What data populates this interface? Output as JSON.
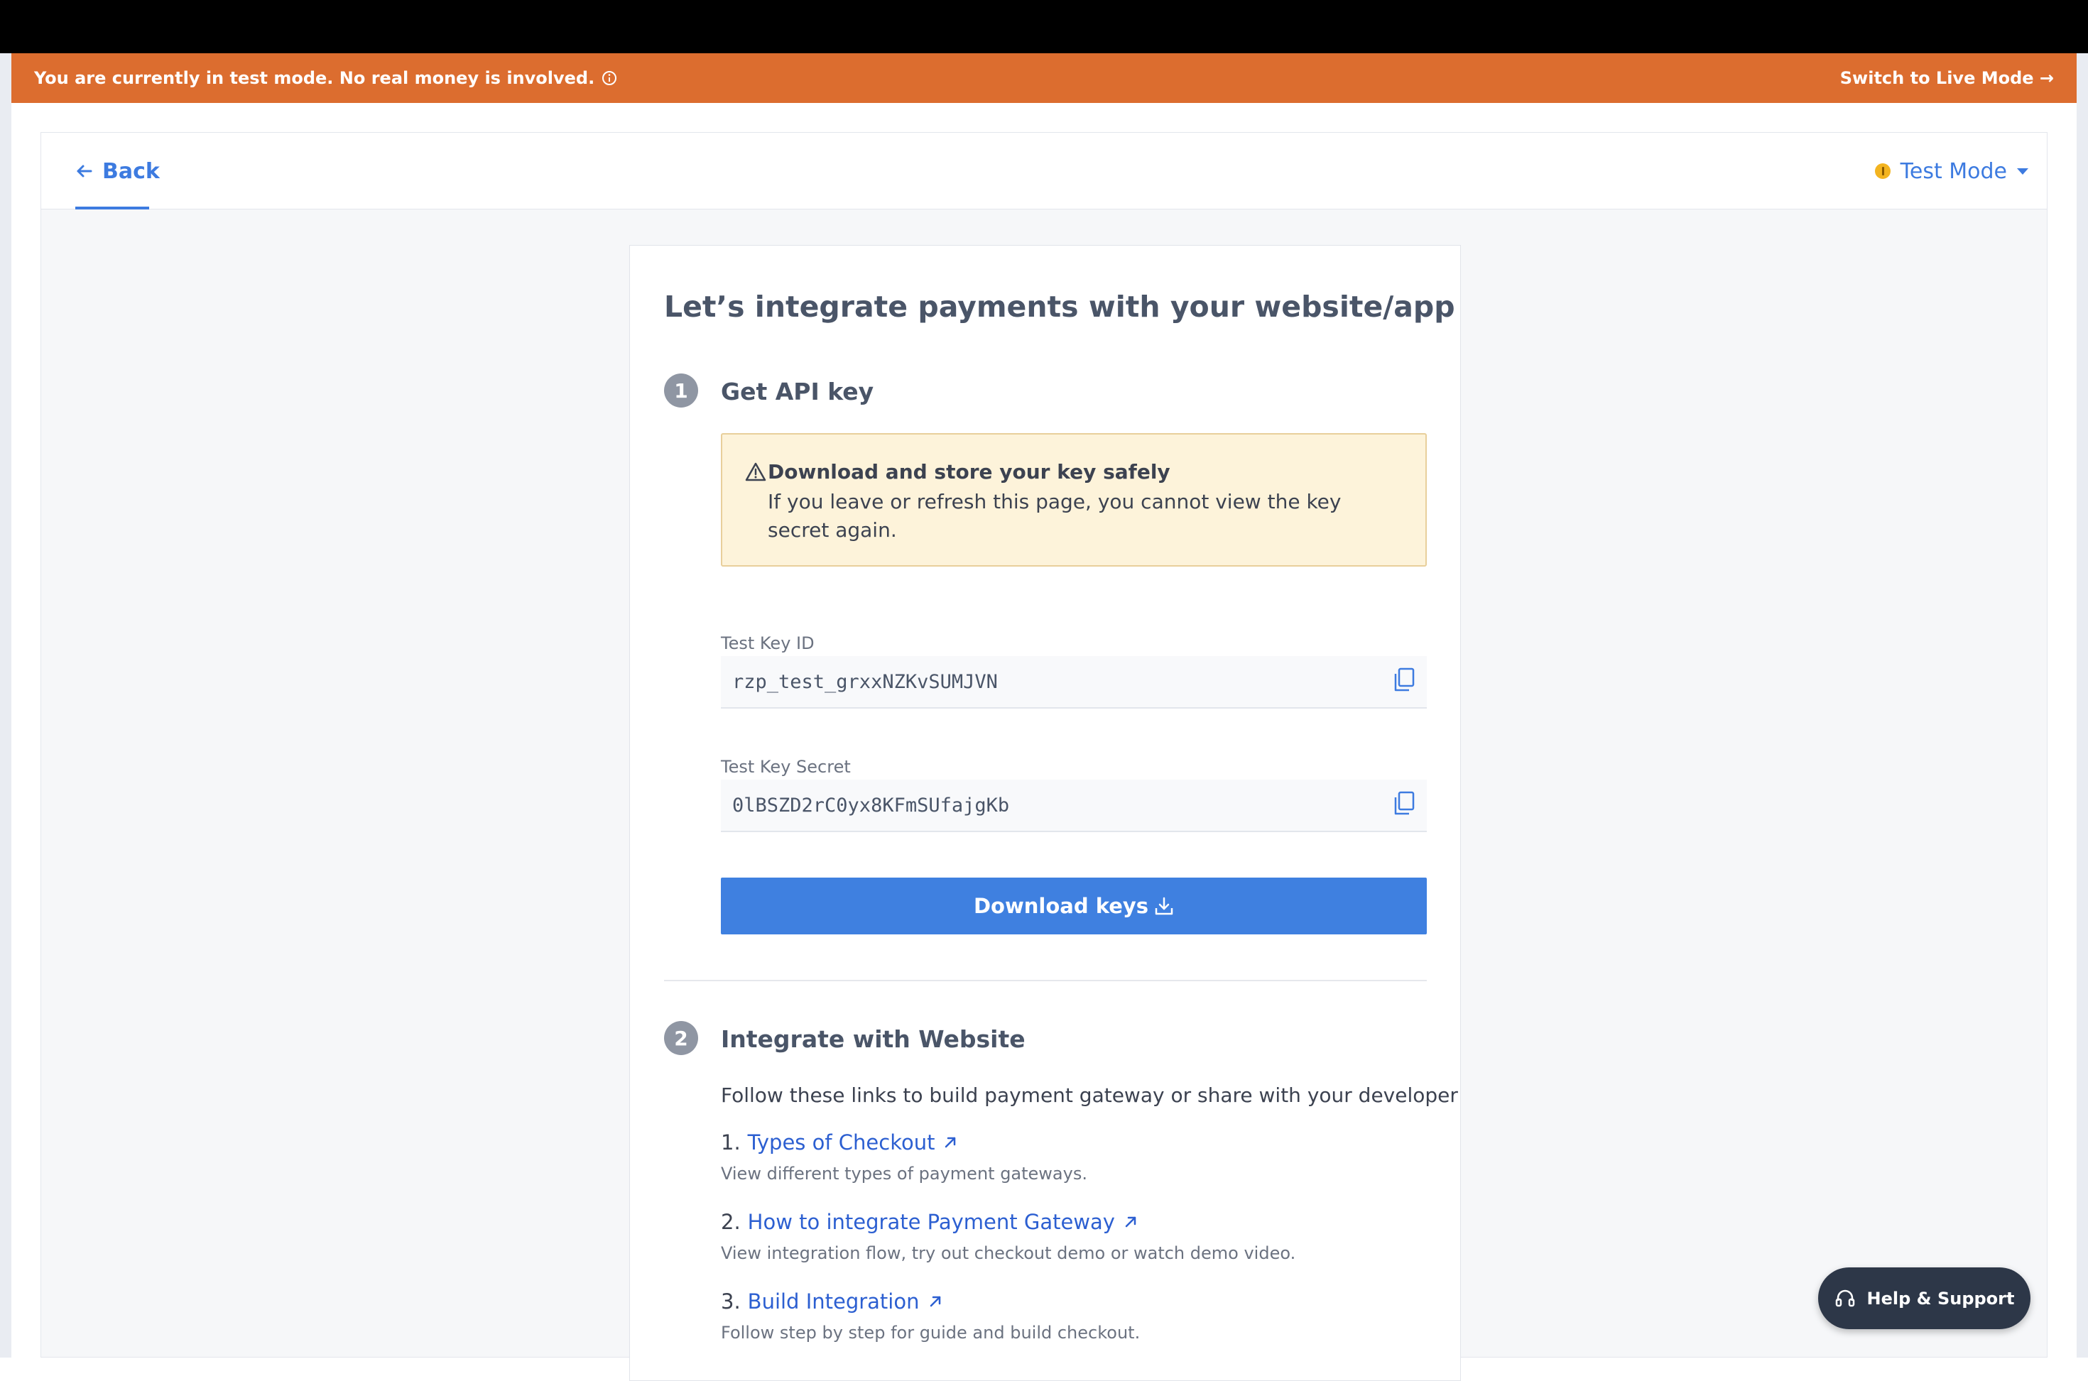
{
  "banner": {
    "message": "You are currently in test mode. No real money is involved.",
    "switch_label": "Switch to Live Mode →",
    "color": "#dc6d2f"
  },
  "nav": {
    "back_label": "Back",
    "mode_label": "Test Mode"
  },
  "card": {
    "title": "Let’s integrate payments with your website/app",
    "step1": {
      "number": "1",
      "title": "Get API key",
      "warning_title": "Download and store your key safely",
      "warning_text": "If you leave or refresh this page, you cannot view the key secret again.",
      "key_id_label": "Test Key ID",
      "key_id_value": "rzp_test_grxxNZKvSUMJVN",
      "key_secret_label": "Test Key Secret",
      "key_secret_value": "0lBSZD2rC0yx8KFmSUfajgKb",
      "download_label": "Download keys"
    },
    "step2": {
      "number": "2",
      "title": "Integrate with Website",
      "intro": "Follow these links to build payment gateway or share with your developer",
      "links": [
        {
          "num": "1.",
          "label": "Types of Checkout",
          "desc": "View different types of payment gateways."
        },
        {
          "num": "2.",
          "label": "How to integrate Payment Gateway",
          "desc": "View integration flow, try out checkout demo or watch demo video."
        },
        {
          "num": "3.",
          "label": "Build Integration",
          "desc": "Follow step by step for guide and build checkout."
        }
      ]
    }
  },
  "help": {
    "label": "Help & Support"
  },
  "colors": {
    "primary": "#3f80e0",
    "link": "#2c5fd1",
    "warning_bg": "#fdf3da",
    "help_bg": "#2d3748"
  }
}
